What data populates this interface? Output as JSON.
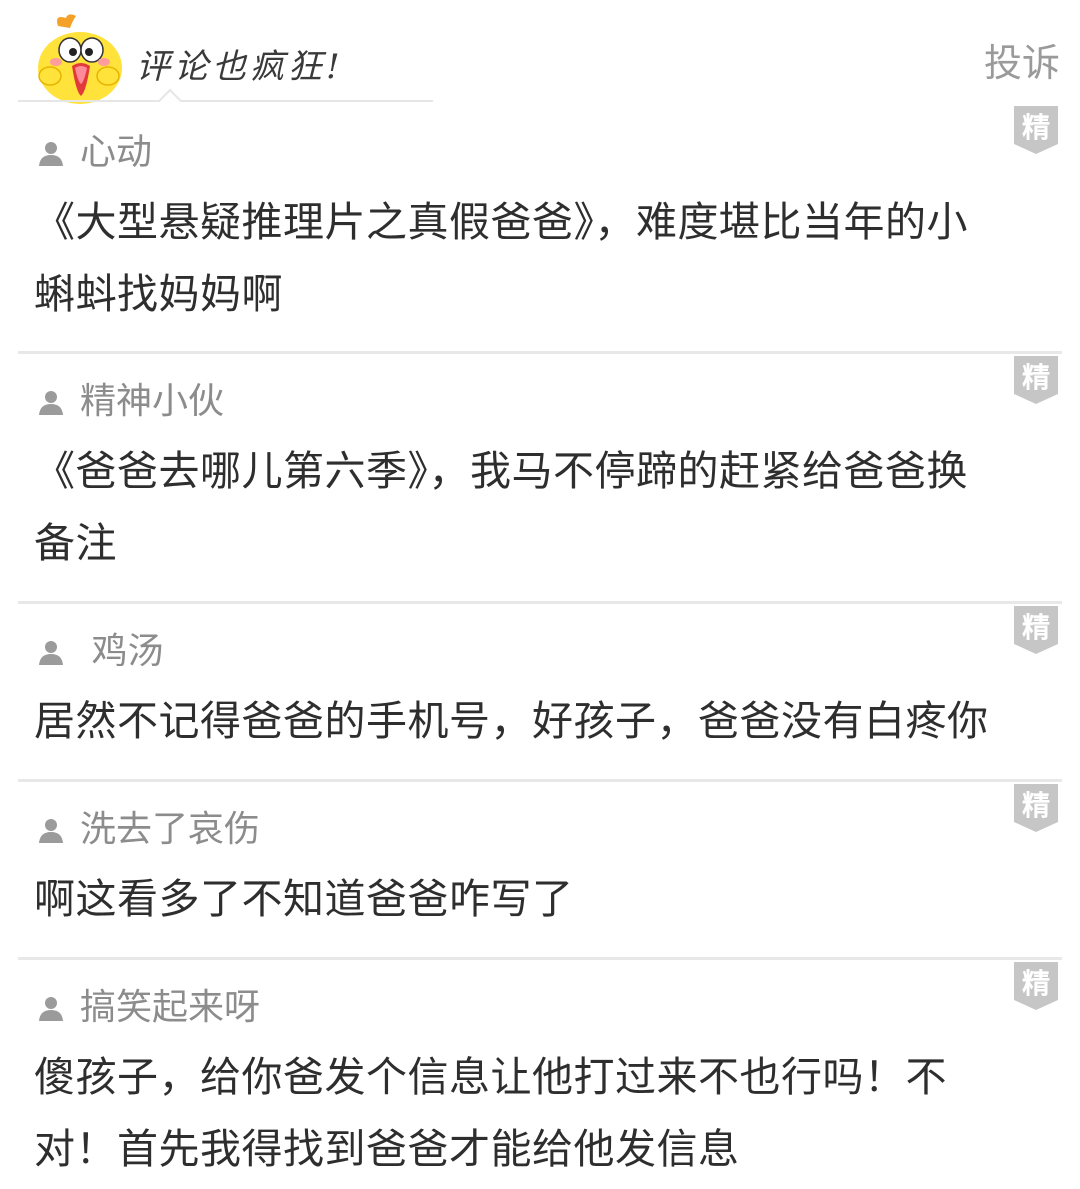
{
  "header": {
    "title": "评论也疯狂!",
    "report_label": "投诉",
    "mascot_icon": "yellow-chick-mascot"
  },
  "colors": {
    "divider": "#e8e8e8",
    "author": "#8c8c8c",
    "badge": "#c6c6c6",
    "text": "#2e2e2e"
  },
  "comments": [
    {
      "author": "心动",
      "text_lines": [
        "《大型悬疑推理片之真假爸爸》，难度堪比当年的小",
        "蝌蚪找妈妈啊"
      ],
      "badge": "精"
    },
    {
      "author": "精神小伙",
      "text_lines": [
        "《爸爸去哪儿第六季》，我马不停蹄的赶紧给爸爸换",
        "备注"
      ],
      "badge": "精"
    },
    {
      "author": " 鸡汤",
      "text_lines": [
        "居然不记得爸爸的手机号，好孩子，爸爸没有白疼你"
      ],
      "badge": "精"
    },
    {
      "author": "洗去了哀伤",
      "text_lines": [
        "啊这看多了不知道爸爸咋写了"
      ],
      "badge": "精"
    },
    {
      "author": "搞笑起来呀",
      "text_lines": [
        "傻孩子，给你爸发个信息让他打过来不也行吗！不",
        "对！首先我得找到爸爸才能给他发信息"
      ],
      "badge": "精"
    }
  ]
}
